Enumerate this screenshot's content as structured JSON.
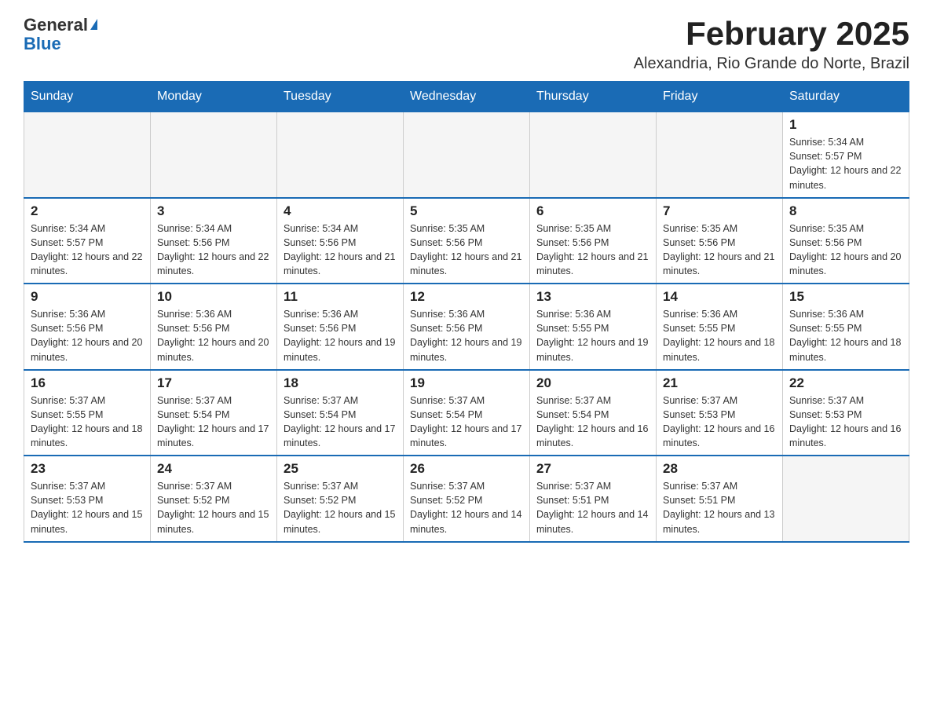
{
  "header": {
    "logo_general": "General",
    "logo_blue": "Blue",
    "month_title": "February 2025",
    "location": "Alexandria, Rio Grande do Norte, Brazil"
  },
  "weekdays": [
    "Sunday",
    "Monday",
    "Tuesday",
    "Wednesday",
    "Thursday",
    "Friday",
    "Saturday"
  ],
  "weeks": [
    [
      {
        "day": "",
        "info": ""
      },
      {
        "day": "",
        "info": ""
      },
      {
        "day": "",
        "info": ""
      },
      {
        "day": "",
        "info": ""
      },
      {
        "day": "",
        "info": ""
      },
      {
        "day": "",
        "info": ""
      },
      {
        "day": "1",
        "info": "Sunrise: 5:34 AM\nSunset: 5:57 PM\nDaylight: 12 hours and 22 minutes."
      }
    ],
    [
      {
        "day": "2",
        "info": "Sunrise: 5:34 AM\nSunset: 5:57 PM\nDaylight: 12 hours and 22 minutes."
      },
      {
        "day": "3",
        "info": "Sunrise: 5:34 AM\nSunset: 5:56 PM\nDaylight: 12 hours and 22 minutes."
      },
      {
        "day": "4",
        "info": "Sunrise: 5:34 AM\nSunset: 5:56 PM\nDaylight: 12 hours and 21 minutes."
      },
      {
        "day": "5",
        "info": "Sunrise: 5:35 AM\nSunset: 5:56 PM\nDaylight: 12 hours and 21 minutes."
      },
      {
        "day": "6",
        "info": "Sunrise: 5:35 AM\nSunset: 5:56 PM\nDaylight: 12 hours and 21 minutes."
      },
      {
        "day": "7",
        "info": "Sunrise: 5:35 AM\nSunset: 5:56 PM\nDaylight: 12 hours and 21 minutes."
      },
      {
        "day": "8",
        "info": "Sunrise: 5:35 AM\nSunset: 5:56 PM\nDaylight: 12 hours and 20 minutes."
      }
    ],
    [
      {
        "day": "9",
        "info": "Sunrise: 5:36 AM\nSunset: 5:56 PM\nDaylight: 12 hours and 20 minutes."
      },
      {
        "day": "10",
        "info": "Sunrise: 5:36 AM\nSunset: 5:56 PM\nDaylight: 12 hours and 20 minutes."
      },
      {
        "day": "11",
        "info": "Sunrise: 5:36 AM\nSunset: 5:56 PM\nDaylight: 12 hours and 19 minutes."
      },
      {
        "day": "12",
        "info": "Sunrise: 5:36 AM\nSunset: 5:56 PM\nDaylight: 12 hours and 19 minutes."
      },
      {
        "day": "13",
        "info": "Sunrise: 5:36 AM\nSunset: 5:55 PM\nDaylight: 12 hours and 19 minutes."
      },
      {
        "day": "14",
        "info": "Sunrise: 5:36 AM\nSunset: 5:55 PM\nDaylight: 12 hours and 18 minutes."
      },
      {
        "day": "15",
        "info": "Sunrise: 5:36 AM\nSunset: 5:55 PM\nDaylight: 12 hours and 18 minutes."
      }
    ],
    [
      {
        "day": "16",
        "info": "Sunrise: 5:37 AM\nSunset: 5:55 PM\nDaylight: 12 hours and 18 minutes."
      },
      {
        "day": "17",
        "info": "Sunrise: 5:37 AM\nSunset: 5:54 PM\nDaylight: 12 hours and 17 minutes."
      },
      {
        "day": "18",
        "info": "Sunrise: 5:37 AM\nSunset: 5:54 PM\nDaylight: 12 hours and 17 minutes."
      },
      {
        "day": "19",
        "info": "Sunrise: 5:37 AM\nSunset: 5:54 PM\nDaylight: 12 hours and 17 minutes."
      },
      {
        "day": "20",
        "info": "Sunrise: 5:37 AM\nSunset: 5:54 PM\nDaylight: 12 hours and 16 minutes."
      },
      {
        "day": "21",
        "info": "Sunrise: 5:37 AM\nSunset: 5:53 PM\nDaylight: 12 hours and 16 minutes."
      },
      {
        "day": "22",
        "info": "Sunrise: 5:37 AM\nSunset: 5:53 PM\nDaylight: 12 hours and 16 minutes."
      }
    ],
    [
      {
        "day": "23",
        "info": "Sunrise: 5:37 AM\nSunset: 5:53 PM\nDaylight: 12 hours and 15 minutes."
      },
      {
        "day": "24",
        "info": "Sunrise: 5:37 AM\nSunset: 5:52 PM\nDaylight: 12 hours and 15 minutes."
      },
      {
        "day": "25",
        "info": "Sunrise: 5:37 AM\nSunset: 5:52 PM\nDaylight: 12 hours and 15 minutes."
      },
      {
        "day": "26",
        "info": "Sunrise: 5:37 AM\nSunset: 5:52 PM\nDaylight: 12 hours and 14 minutes."
      },
      {
        "day": "27",
        "info": "Sunrise: 5:37 AM\nSunset: 5:51 PM\nDaylight: 12 hours and 14 minutes."
      },
      {
        "day": "28",
        "info": "Sunrise: 5:37 AM\nSunset: 5:51 PM\nDaylight: 12 hours and 13 minutes."
      },
      {
        "day": "",
        "info": ""
      }
    ]
  ]
}
